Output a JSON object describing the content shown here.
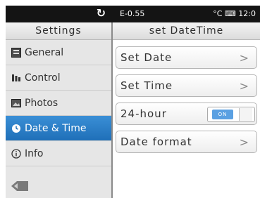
{
  "status_bar": {
    "refresh_icon": "refresh-icon",
    "left_text": "E-0.55",
    "right_text": "°C ⌨ 12:0"
  },
  "left_panel": {
    "title": "Settings",
    "items": [
      {
        "label": "General",
        "icon": "general-icon"
      },
      {
        "label": "Control",
        "icon": "control-icon"
      },
      {
        "label": "Photos",
        "icon": "photos-icon"
      },
      {
        "label": "Date & Time",
        "icon": "clock-icon",
        "selected": true
      },
      {
        "label": "Info",
        "icon": "info-icon"
      }
    ],
    "back_icon": "back-icon"
  },
  "right_panel": {
    "title": "set DateTime",
    "options": [
      {
        "label": "Set Date",
        "type": "link"
      },
      {
        "label": "Set Time",
        "type": "link"
      },
      {
        "label": "24-hour",
        "type": "toggle",
        "toggle_text": "ON",
        "enabled": true
      },
      {
        "label": "Date format",
        "type": "link"
      }
    ]
  },
  "colors": {
    "accent": "#1f6fb8",
    "toggle_on": "#5aa0e2",
    "status_bar": "#141414"
  }
}
